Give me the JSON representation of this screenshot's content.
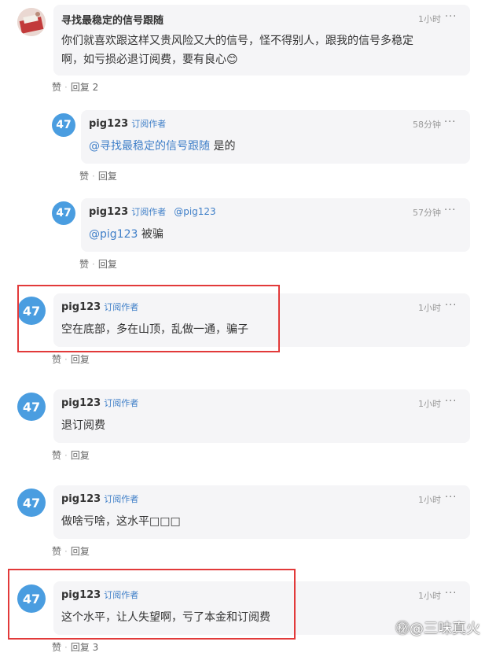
{
  "comments": [
    {
      "name": "寻找最稳定的信号跟随",
      "time": "1小时",
      "text_line1": "你们就喜欢跟这样又贵风险又大的信号，怪不得别人，跟我的信号多稳定",
      "text_line2": "啊，如亏损必退订阅费，要有良心😊",
      "like": "赞",
      "reply": "回复 2"
    },
    {
      "avatar": "47",
      "name": "pig123",
      "badge": "订阅作者",
      "time": "58分钟",
      "mention": "@寻找最稳定的信号跟随",
      "text": " 是的",
      "like": "赞",
      "reply": "回复"
    },
    {
      "avatar": "47",
      "name": "pig123",
      "badge": "订阅作者",
      "reply_to": "@pig123",
      "time": "57分钟",
      "mention": "@pig123",
      "text": " 被骗",
      "like": "赞",
      "reply": "回复"
    },
    {
      "avatar": "47",
      "name": "pig123",
      "badge": "订阅作者",
      "time": "1小时",
      "text": "空在底部，多在山顶，乱做一通，骗子",
      "like": "赞",
      "reply": "回复"
    },
    {
      "avatar": "47",
      "name": "pig123",
      "badge": "订阅作者",
      "time": "1小时",
      "text": "退订阅费",
      "like": "赞",
      "reply": "回复"
    },
    {
      "avatar": "47",
      "name": "pig123",
      "badge": "订阅作者",
      "time": "1小时",
      "text": "做啥亏啥，这水平□□□",
      "like": "赞",
      "reply": "回复"
    },
    {
      "avatar": "47",
      "name": "pig123",
      "badge": "订阅作者",
      "time": "1小时",
      "text": "这个水平，让人失望啊，亏了本金和订阅费",
      "like": "赞",
      "reply": "回复 3"
    }
  ],
  "more_icon": "···",
  "watermark": "㊙@三味真火",
  "colors": {
    "accent": "#3f7fc8",
    "avatar": "#4a9de0",
    "highlight": "#e23a3a",
    "bubble": "#f5f5f7"
  }
}
